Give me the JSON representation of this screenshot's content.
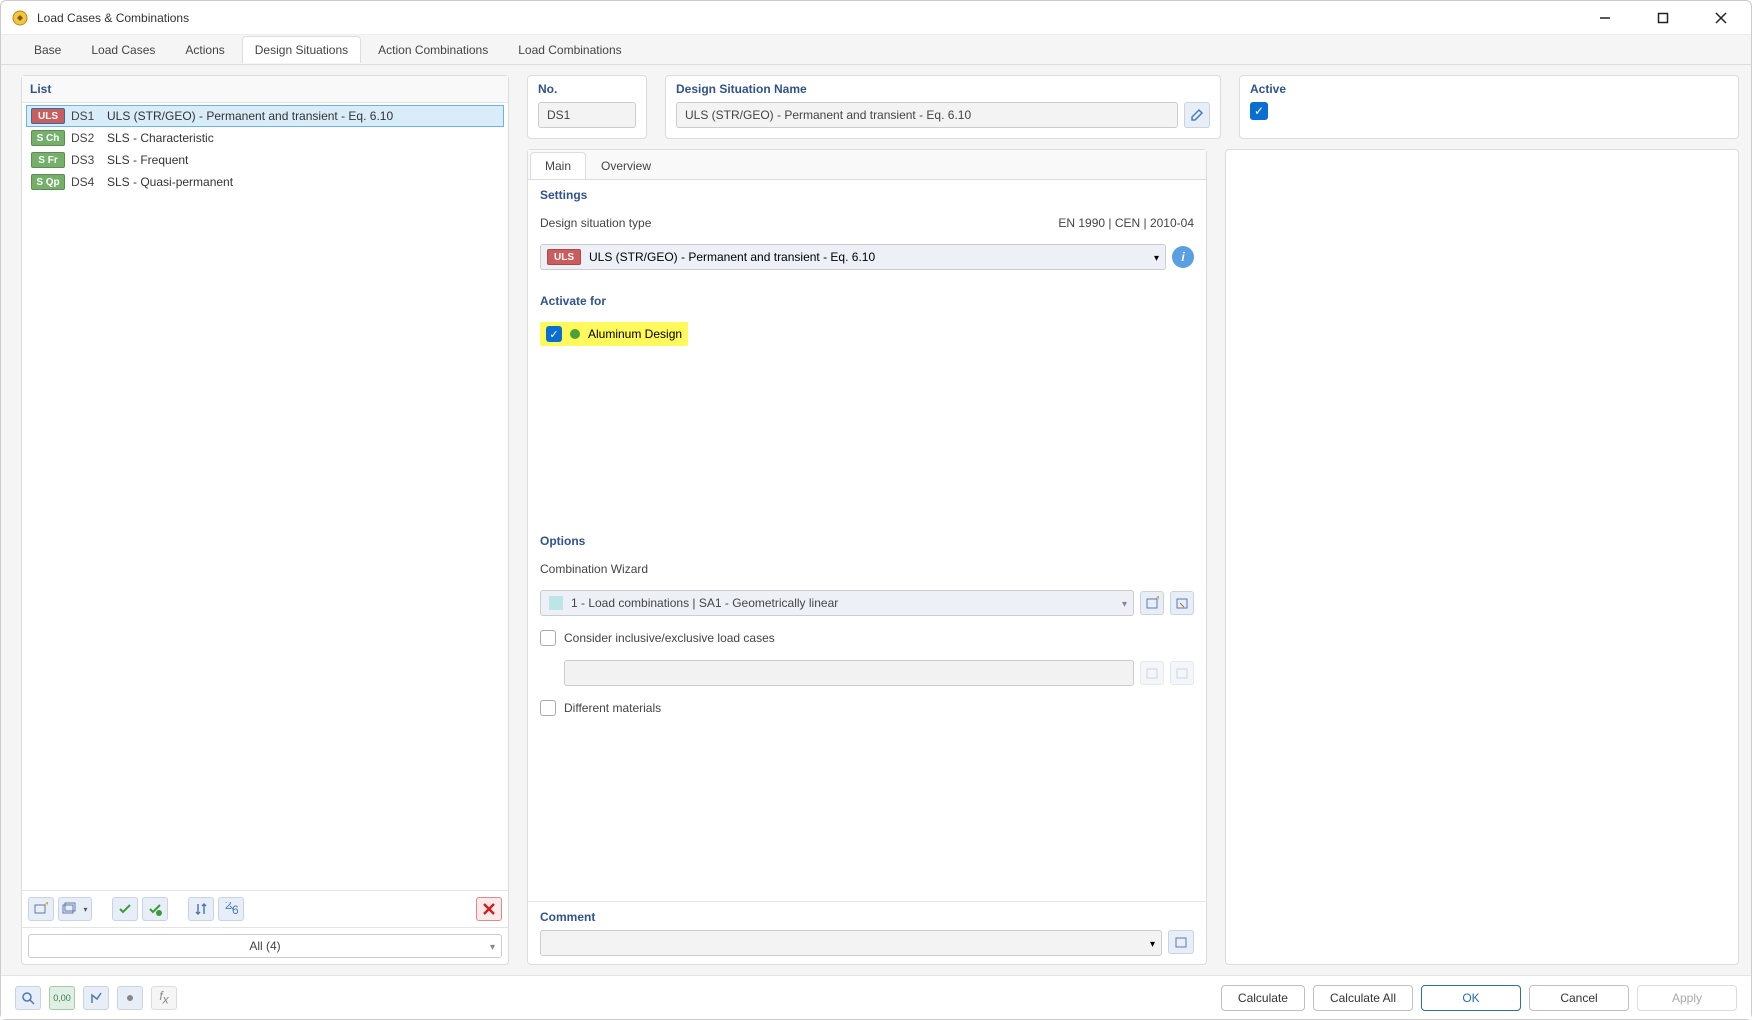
{
  "window": {
    "title": "Load Cases & Combinations"
  },
  "tabs": [
    "Base",
    "Load Cases",
    "Actions",
    "Design Situations",
    "Action Combinations",
    "Load Combinations"
  ],
  "active_tab_index": 3,
  "list": {
    "header": "List",
    "items": [
      {
        "badge_class": "uls sel",
        "badge": "ULS",
        "num": "DS1",
        "name": "ULS (STR/GEO) - Permanent and transient - Eq. 6.10",
        "selected": true
      },
      {
        "badge_class": "sch",
        "badge": "S Ch",
        "num": "DS2",
        "name": "SLS - Characteristic"
      },
      {
        "badge_class": "sfr",
        "badge": "S Fr",
        "num": "DS3",
        "name": "SLS - Frequent"
      },
      {
        "badge_class": "sqp",
        "badge": "S Qp",
        "num": "DS4",
        "name": "SLS - Quasi-permanent"
      }
    ],
    "filter": "All (4)"
  },
  "detail": {
    "no_label": "No.",
    "no_value": "DS1",
    "name_label": "Design Situation Name",
    "name_value": "ULS (STR/GEO) - Permanent and transient - Eq. 6.10",
    "active_label": "Active",
    "inner_tabs": [
      "Main",
      "Overview"
    ],
    "active_inner_tab": 0,
    "settings_title": "Settings",
    "ds_type_label": "Design situation type",
    "ds_type_standard": "EN 1990 | CEN | 2010-04",
    "ds_type_badge": "ULS",
    "ds_type_value": "ULS (STR/GEO) - Permanent and transient - Eq. 6.10",
    "activate_title": "Activate for",
    "activate_item": "Aluminum Design",
    "options_title": "Options",
    "combo_wizard_label": "Combination Wizard",
    "combo_wizard_value": "1 - Load combinations | SA1 - Geometrically linear",
    "opt_inclusive": "Consider inclusive/exclusive load cases",
    "opt_materials": "Different materials",
    "comment_title": "Comment"
  },
  "footer": {
    "calculate": "Calculate",
    "calculate_all": "Calculate All",
    "ok": "OK",
    "cancel": "Cancel",
    "apply": "Apply"
  }
}
